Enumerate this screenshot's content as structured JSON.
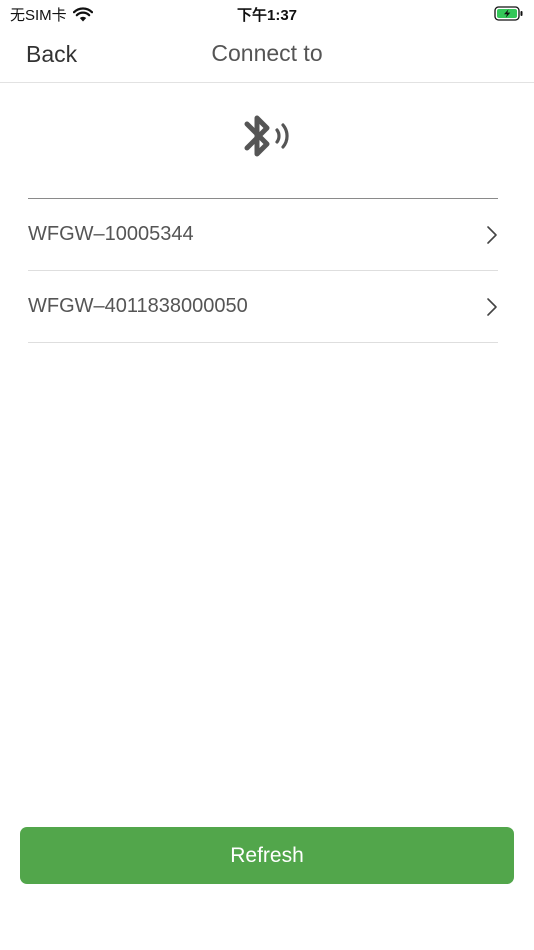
{
  "status_bar": {
    "carrier": "无SIM卡",
    "time": "下午1:37",
    "battery_color": "#34c759"
  },
  "nav": {
    "back_label": "Back",
    "title": "Connect to"
  },
  "icons": {
    "header": "bluetooth-signal-icon",
    "row": "chevron-right-icon"
  },
  "devices": [
    {
      "name": "WFGW–10005344"
    },
    {
      "name": "WFGW–4011838000050"
    }
  ],
  "refresh": {
    "label": "Refresh",
    "color": "#52a64b"
  }
}
